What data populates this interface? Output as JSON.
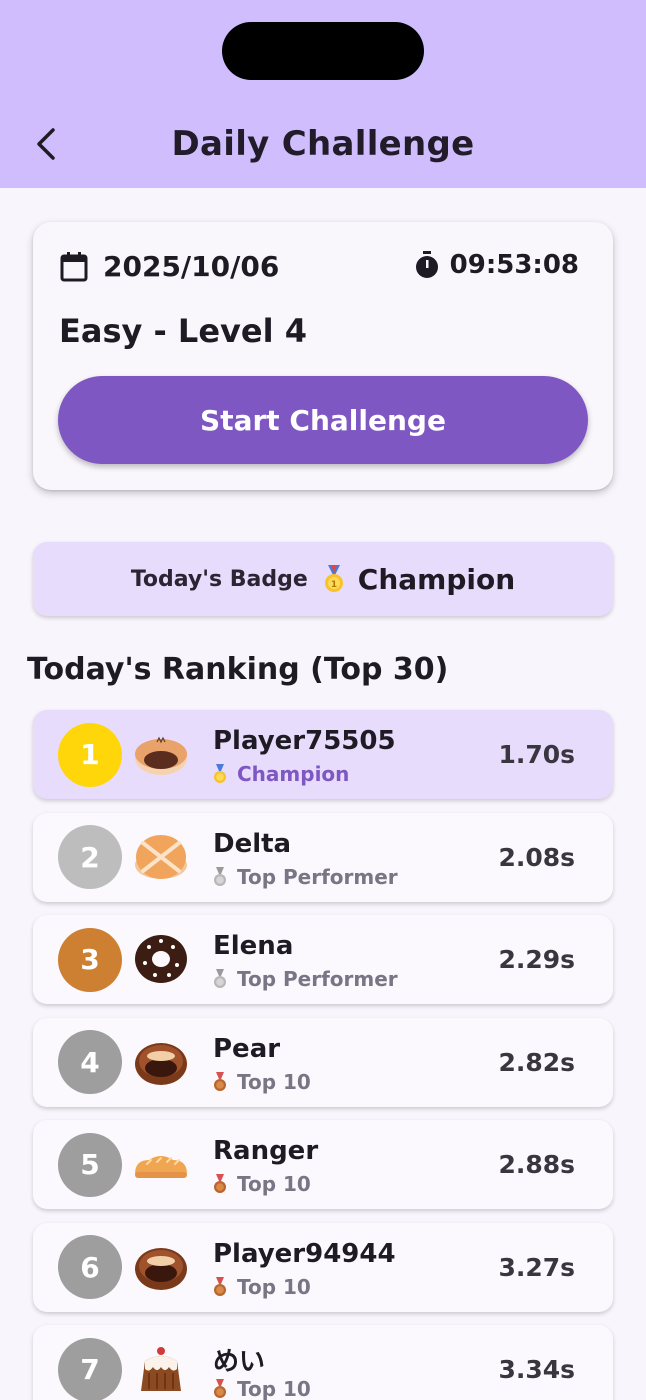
{
  "header": {
    "title": "Daily Challenge"
  },
  "challenge": {
    "date": "2025/10/06",
    "timer": "09:53:08",
    "level": "Easy - Level 4",
    "start_label": "Start Challenge"
  },
  "badge": {
    "label": "Today's Badge",
    "name": "Champion"
  },
  "ranking": {
    "title": "Today's Ranking (Top 30)",
    "rows": [
      {
        "rank": "1",
        "name": "Player75505",
        "badge": "Champion",
        "time": "1.70s"
      },
      {
        "rank": "2",
        "name": "Delta",
        "badge": "Top Performer",
        "time": "2.08s"
      },
      {
        "rank": "3",
        "name": "Elena",
        "badge": "Top Performer",
        "time": "2.29s"
      },
      {
        "rank": "4",
        "name": "Pear",
        "badge": "Top 10",
        "time": "2.82s"
      },
      {
        "rank": "5",
        "name": "Ranger",
        "badge": "Top 10",
        "time": "2.88s"
      },
      {
        "rank": "6",
        "name": "Player94944",
        "badge": "Top 10",
        "time": "3.27s"
      },
      {
        "rank": "7",
        "name": "めい",
        "badge": "Top 10",
        "time": "3.34s"
      }
    ]
  },
  "colors": {
    "header_bg": "#cfbdfd",
    "accent": "#7e57c2",
    "gold": "#ffd60a",
    "silver": "#bdbdbd",
    "bronze": "#cd7f32",
    "gray_rank": "#9e9e9e",
    "highlight_row": "#e8dcfd"
  }
}
